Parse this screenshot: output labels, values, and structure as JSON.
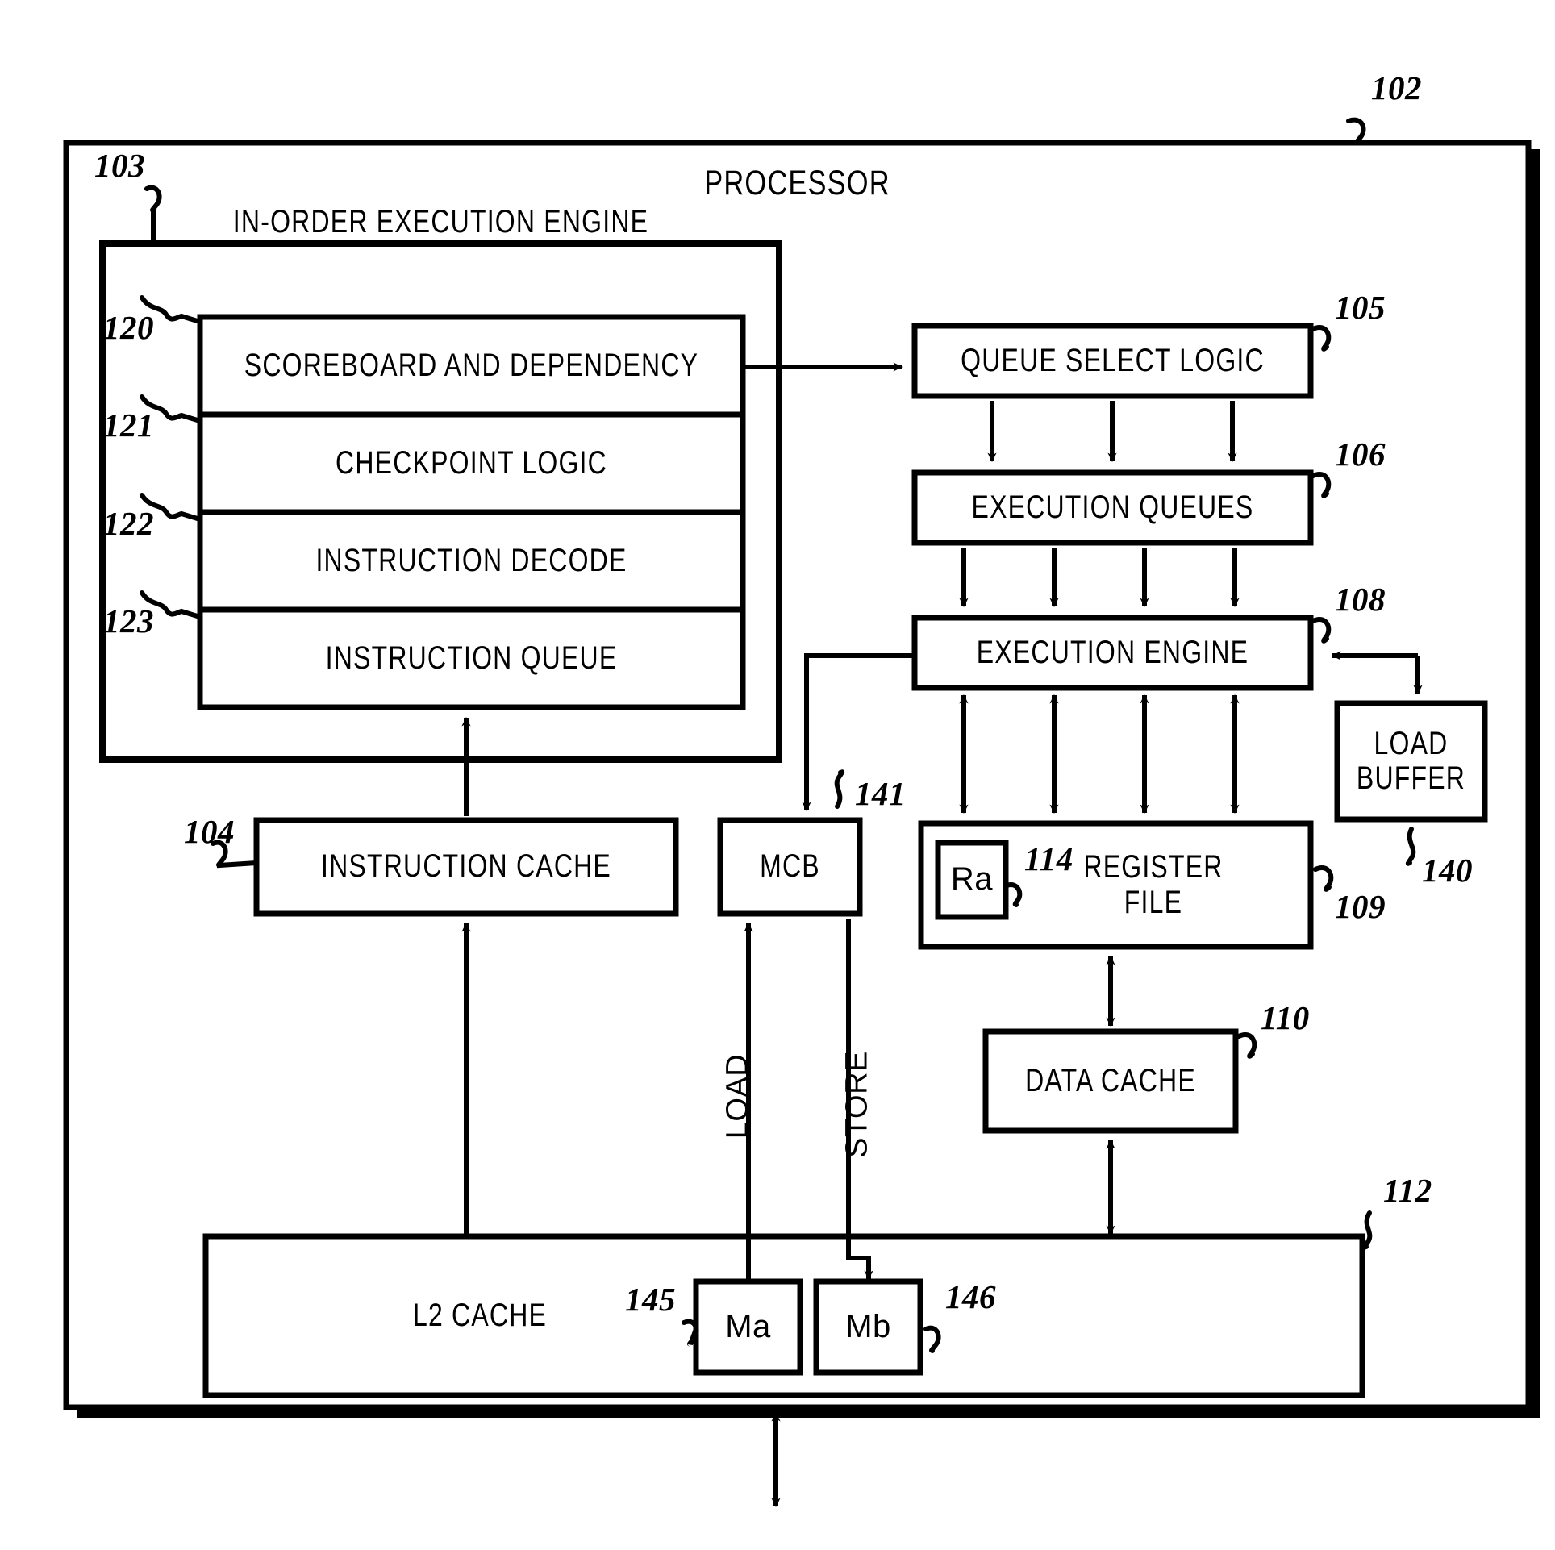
{
  "figure": {
    "title": "PROCESSOR",
    "type": "patent-block-diagram"
  },
  "blocks": {
    "processor": {
      "label": "PROCESSOR",
      "ref": "102"
    },
    "in_order_engine": {
      "label": "IN-ORDER EXECUTION ENGINE",
      "ref": "103"
    },
    "scoreboard": {
      "label": "SCOREBOARD AND DEPENDENCY",
      "ref": "120"
    },
    "checkpoint_logic": {
      "label": "CHECKPOINT LOGIC",
      "ref": "121"
    },
    "instruction_decode": {
      "label": "INSTRUCTION DECODE",
      "ref": "122"
    },
    "instruction_queue": {
      "label": "INSTRUCTION QUEUE",
      "ref": "123"
    },
    "queue_select_logic": {
      "label": "QUEUE SELECT LOGIC",
      "ref": "105"
    },
    "execution_queues": {
      "label": "EXECUTION QUEUES",
      "ref": "106"
    },
    "execution_engine": {
      "label": "EXECUTION ENGINE",
      "ref": "108"
    },
    "load_buffer": {
      "label": "LOAD BUFFER",
      "ref": "140"
    },
    "instruction_cache": {
      "label": "INSTRUCTION CACHE",
      "ref": "104"
    },
    "mcb": {
      "label": "MCB",
      "ref": "141"
    },
    "register_file": {
      "label": "REGISTER FILE",
      "ref": "109"
    },
    "ra_register": {
      "label": "Ra",
      "ref": "114"
    },
    "data_cache": {
      "label": "DATA CACHE",
      "ref": "110"
    },
    "l2_cache": {
      "label": "L2 CACHE",
      "ref": "112"
    },
    "ma_block": {
      "label": "Ma",
      "ref": "145"
    },
    "mb_block": {
      "label": "Mb",
      "ref": "146"
    }
  },
  "edge_labels": {
    "load": "LOAD",
    "store": "STORE"
  },
  "colors": {
    "stroke": "#000000",
    "fill": "#ffffff",
    "background": "#ffffff"
  }
}
